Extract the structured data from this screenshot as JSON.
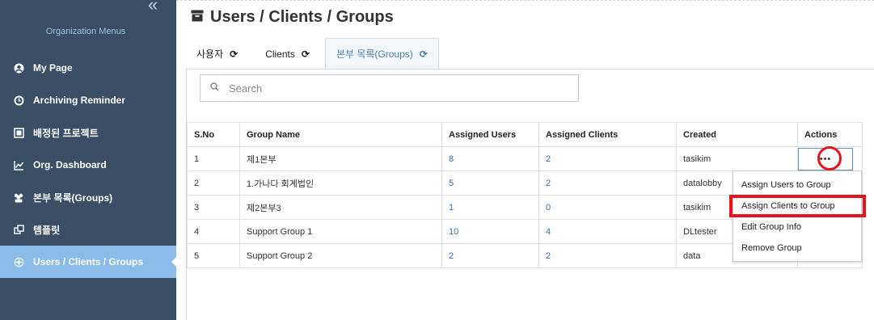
{
  "sidebar": {
    "title": "Organization Menus",
    "items": [
      {
        "label": "My Page",
        "icon": "user-circle-icon"
      },
      {
        "label": "Archiving Reminder",
        "icon": "clock-icon"
      },
      {
        "label": "배정된 프로젝트",
        "icon": "project-icon"
      },
      {
        "label": "Org. Dashboard",
        "icon": "chart-line-icon"
      },
      {
        "label": "본부 목록(Groups)",
        "icon": "users-group-icon"
      },
      {
        "label": "템플릿",
        "icon": "template-icon"
      },
      {
        "label": "Users / Clients / Groups",
        "icon": "org-icon",
        "active": true
      }
    ]
  },
  "header": {
    "title": "Users / Clients / Groups"
  },
  "tabs": [
    {
      "label": "사용자"
    },
    {
      "label": "Clients"
    },
    {
      "label": "본부 목록(Groups)",
      "active": true
    }
  ],
  "search": {
    "placeholder": "Search"
  },
  "table": {
    "headers": [
      "S.No",
      "Group Name",
      "Assigned Users",
      "Assigned Clients",
      "Created",
      "Actions"
    ],
    "rows": [
      {
        "sno": "1",
        "name": "제1본부",
        "users": "8",
        "clients": "2",
        "created": "tasikim"
      },
      {
        "sno": "2",
        "name": "1.가나다 회계법인",
        "users": "5",
        "clients": "2",
        "created": "datalobby"
      },
      {
        "sno": "3",
        "name": "제2본부3",
        "users": "1",
        "clients": "0",
        "created": "tasikim"
      },
      {
        "sno": "4",
        "name": "Support Group 1",
        "users": "10",
        "clients": "4",
        "created": "DLtester"
      },
      {
        "sno": "5",
        "name": "Support Group 2",
        "users": "2",
        "clients": "2",
        "created": "data"
      }
    ],
    "actions_label": "•••"
  },
  "dropdown": {
    "items": [
      {
        "label": "Assign Users to Group"
      },
      {
        "label": "Assign Clients to Group",
        "highlight": true
      },
      {
        "label": "Edit Group Info"
      },
      {
        "label": "Remove Group"
      }
    ]
  },
  "colors": {
    "sidebar_bg": "#3a4f66",
    "active_item": "#8bbbe8",
    "link": "#2f6fb5",
    "highlight_red": "#e3161d"
  }
}
